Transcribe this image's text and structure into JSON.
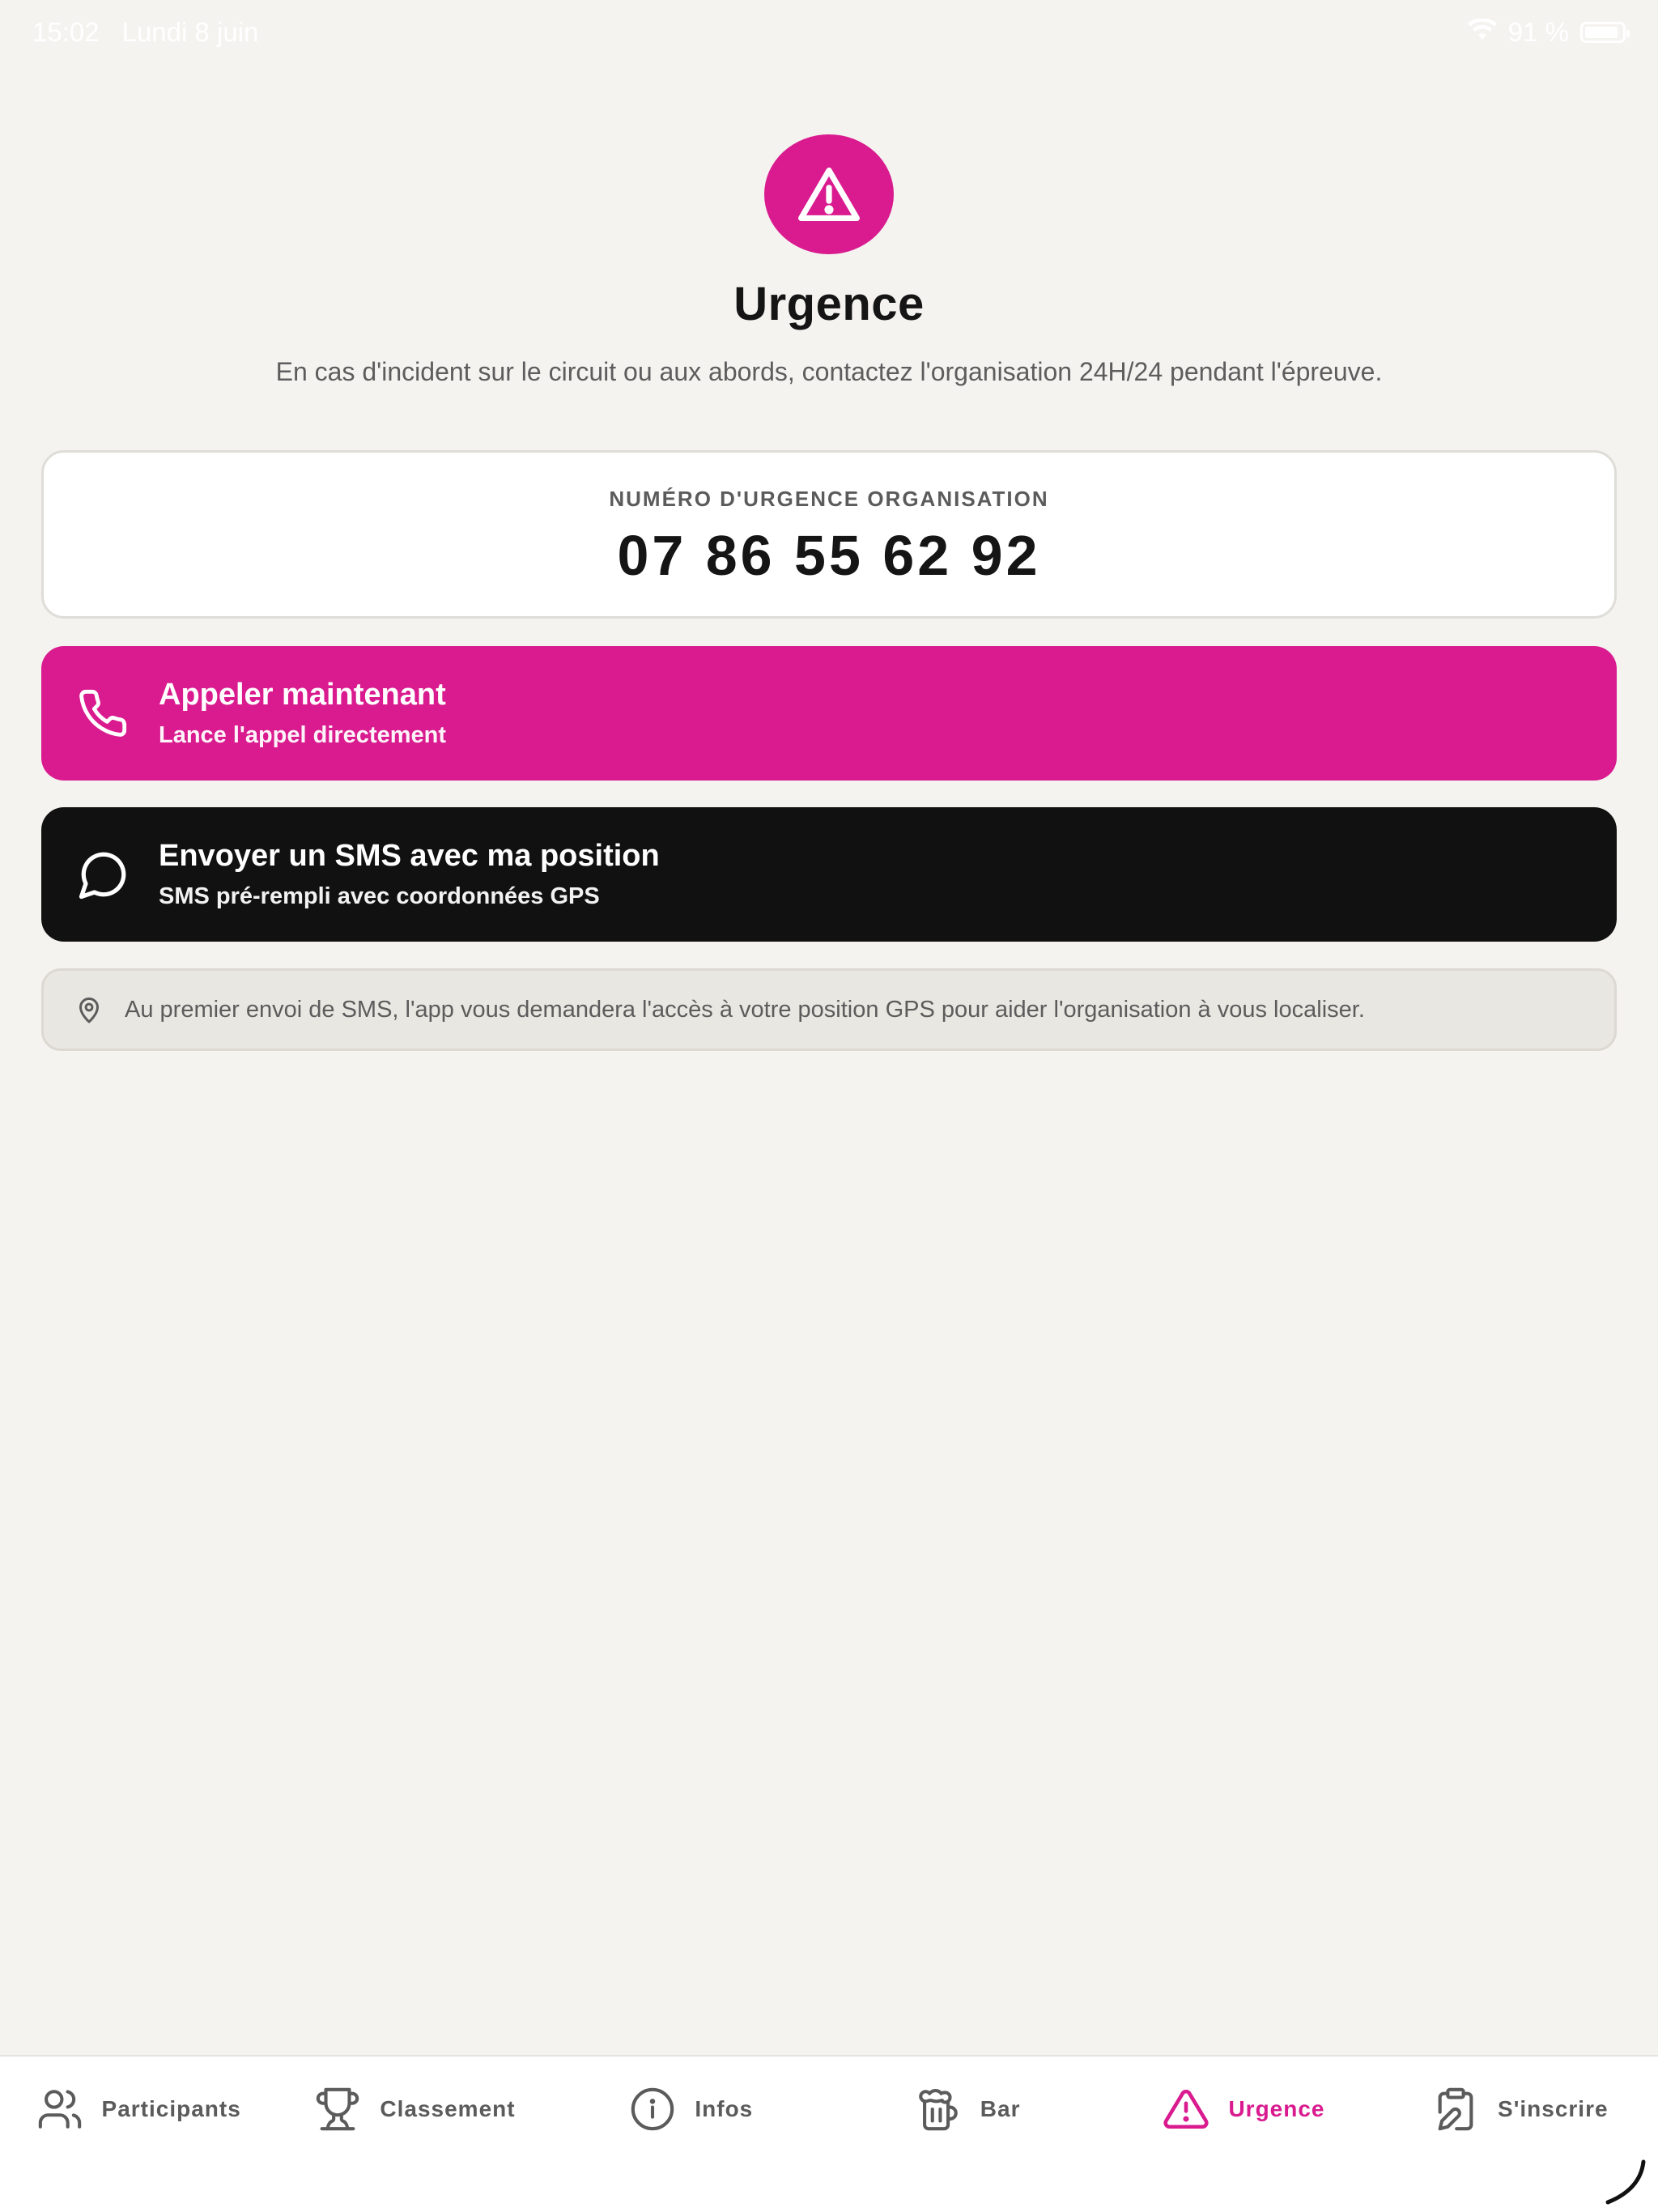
{
  "status_bar": {
    "time": "15:02",
    "date": "Lundi 8 juin",
    "battery_text": "91 %",
    "battery_level": 0.91
  },
  "colors": {
    "accent": "#d91b8f",
    "dark": "#111111",
    "background": "#f4f3f0"
  },
  "header": {
    "icon": "warning-triangle-icon",
    "title": "Urgence",
    "subtitle": "En cas d'incident sur le circuit ou aux abords, contactez l'organisation 24H/24 pendant l'épreuve."
  },
  "emergency_number": {
    "label": "NUMÉRO D'URGENCE ORGANISATION",
    "value": "07 86 55 62 92"
  },
  "actions": {
    "call": {
      "icon": "phone-icon",
      "title": "Appeler maintenant",
      "subtitle": "Lance l'appel directement"
    },
    "sms": {
      "icon": "message-bubble-icon",
      "title": "Envoyer un SMS avec ma position",
      "subtitle": "SMS pré-rempli avec coordonnées GPS"
    }
  },
  "gps_note": {
    "icon": "location-pin-icon",
    "text": "Au premier envoi de SMS, l'app vous demandera l'accès à votre position GPS pour aider l'organisation à vous localiser."
  },
  "tabs": [
    {
      "label": "Participants",
      "icon": "users-icon"
    },
    {
      "label": "Classement",
      "icon": "trophy-icon"
    },
    {
      "label": "Infos",
      "icon": "info-icon"
    },
    {
      "label": "Bar",
      "icon": "beer-mug-icon"
    },
    {
      "label": "Urgence",
      "icon": "warning-triangle-icon",
      "active": true
    },
    {
      "label": "S'inscrire",
      "icon": "clipboard-edit-icon"
    }
  ]
}
